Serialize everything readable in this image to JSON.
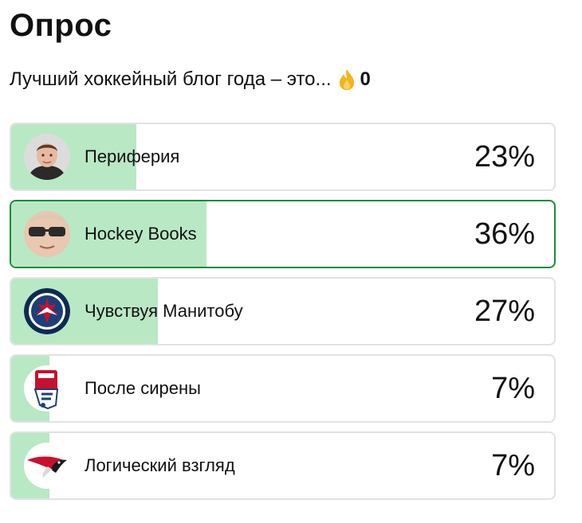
{
  "poll": {
    "title": "Опрос",
    "question": "Лучший хоккейный блог года – это...",
    "reactions_count": "0",
    "accent_color": "#1e8a3c",
    "fill_color": "#b9e8c5",
    "options": [
      {
        "label": "Периферия",
        "percent": "23%",
        "share": 0.23,
        "selected": false,
        "icon": "player-avatar-icon"
      },
      {
        "label": "Hockey Books",
        "percent": "36%",
        "share": 0.36,
        "selected": true,
        "icon": "sunglasses-avatar-icon"
      },
      {
        "label": "Чувствуя Манитобу",
        "percent": "27%",
        "share": 0.27,
        "selected": false,
        "icon": "winnipeg-jets-logo-icon"
      },
      {
        "label": "После сирены",
        "percent": "7%",
        "share": 0.07,
        "selected": false,
        "icon": "iihf-logo-icon"
      },
      {
        "label": "Логический взгляд",
        "percent": "7%",
        "share": 0.07,
        "selected": false,
        "icon": "avangard-logo-icon"
      }
    ]
  }
}
